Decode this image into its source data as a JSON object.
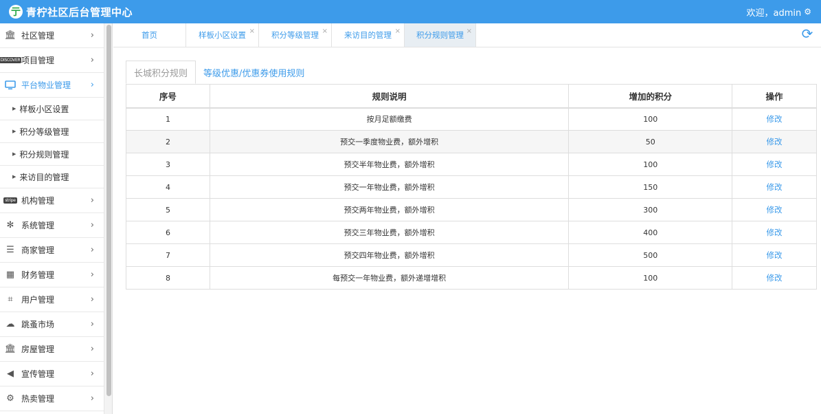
{
  "header": {
    "title": "青柠社区后台管理中心",
    "welcome": "欢迎，admin"
  },
  "sidebar": {
    "items": [
      {
        "label": "社区管理",
        "icon": "bank-icon"
      },
      {
        "label": "项目管理",
        "icon": "discover-card-icon",
        "badge": "DISCOVER"
      },
      {
        "label": "平台物业管理",
        "icon": "monitor-icon",
        "active": true
      },
      {
        "label": "机构管理",
        "icon": "stripe-icon",
        "badge": "stripe"
      },
      {
        "label": "系统管理",
        "icon": "yelp-icon"
      },
      {
        "label": "商家管理",
        "icon": "list-icon"
      },
      {
        "label": "财务管理",
        "icon": "calculator-icon"
      },
      {
        "label": "用户管理",
        "icon": "crop-icon"
      },
      {
        "label": "跳蚤市场",
        "icon": "cloud-icon"
      },
      {
        "label": "房屋管理",
        "icon": "bank-icon"
      },
      {
        "label": "宣传管理",
        "icon": "volume-icon"
      },
      {
        "label": "热卖管理",
        "icon": "gear-icon"
      }
    ],
    "subitems": [
      "样板小区设置",
      "积分等级管理",
      "积分规则管理",
      "来访目的管理"
    ]
  },
  "tabs": [
    {
      "label": "首页",
      "closable": false
    },
    {
      "label": "样板小区设置",
      "closable": true
    },
    {
      "label": "积分等级管理",
      "closable": true
    },
    {
      "label": "来访目的管理",
      "closable": true
    },
    {
      "label": "积分规则管理",
      "closable": true,
      "active": true
    }
  ],
  "subtabs": [
    "长城积分规则",
    "等级优惠/优惠券使用规则"
  ],
  "table": {
    "headers": [
      "序号",
      "规则说明",
      "增加的积分",
      "操作"
    ],
    "action_label": "修改",
    "rows": [
      {
        "no": "1",
        "desc": "按月足额缴费",
        "points": "100"
      },
      {
        "no": "2",
        "desc": "预交一季度物业费，额外增积",
        "points": "50"
      },
      {
        "no": "3",
        "desc": "预交半年物业费，额外增积",
        "points": "100"
      },
      {
        "no": "4",
        "desc": "预交一年物业费，额外增积",
        "points": "150"
      },
      {
        "no": "5",
        "desc": "预交两年物业费，额外增积",
        "points": "300"
      },
      {
        "no": "6",
        "desc": "预交三年物业费，额外增积",
        "points": "400"
      },
      {
        "no": "7",
        "desc": "预交四年物业费，额外增积",
        "points": "500"
      },
      {
        "no": "8",
        "desc": "每预交一年物业费，额外递增增积",
        "points": "100"
      }
    ]
  },
  "colors": {
    "accent": "#3d9bea",
    "header_bg": "#3d9bea",
    "logo_green": "#27a847"
  }
}
